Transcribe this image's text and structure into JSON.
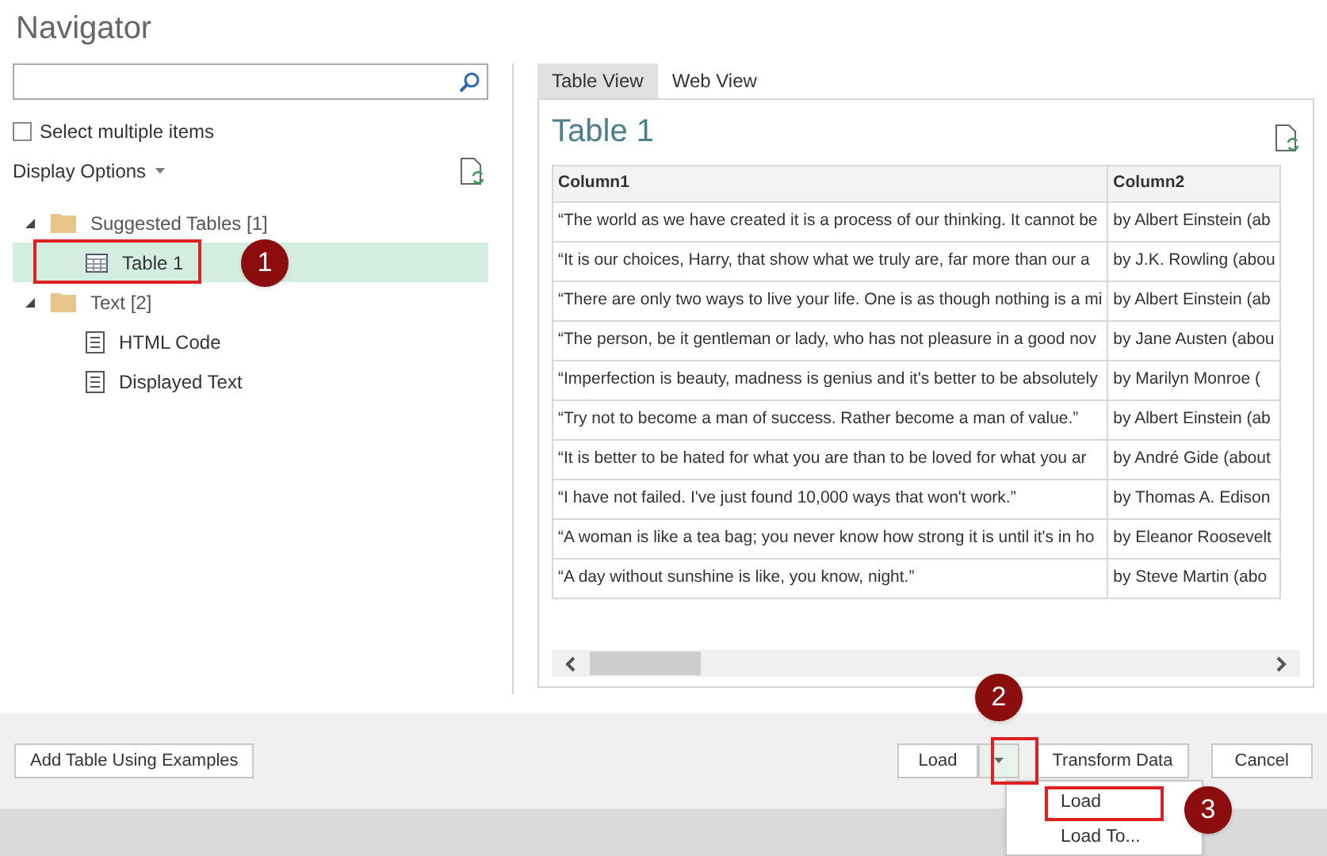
{
  "window": {
    "title": "Navigator"
  },
  "select_multiple": {
    "label": "Select multiple items",
    "checked": false
  },
  "display_options": {
    "label": "Display Options"
  },
  "tree": [
    {
      "label": "Suggested Tables [1]",
      "kind": "folder",
      "expanded": true,
      "selected": false,
      "children": [
        {
          "label": "Table 1",
          "kind": "table",
          "selected": true
        }
      ]
    },
    {
      "label": "Text [2]",
      "kind": "folder",
      "expanded": true,
      "selected": false,
      "children": [
        {
          "label": "HTML Code",
          "kind": "text",
          "selected": false
        },
        {
          "label": "Displayed Text",
          "kind": "text",
          "selected": false
        }
      ]
    }
  ],
  "tabs": [
    {
      "label": "Table View",
      "selected": true
    },
    {
      "label": "Web View",
      "selected": false
    }
  ],
  "preview": {
    "title": "Table 1",
    "columns": [
      "Column1",
      "Column2"
    ],
    "rows": [
      [
        "“The world as we have created it is a process of our thinking. It cannot be",
        "by Albert Einstein (ab"
      ],
      [
        "“It is our choices, Harry, that show what we truly are, far more than our a",
        "by J.K. Rowling (abou"
      ],
      [
        "“There are only two ways to live your life. One is as though nothing is a mi",
        "by Albert Einstein (ab"
      ],
      [
        "“The person, be it gentleman or lady, who has not pleasure in a good nov",
        "by Jane Austen (abou"
      ],
      [
        "“Imperfection is beauty, madness is genius and it's better to be absolutely",
        "by Marilyn Monroe ("
      ],
      [
        "“Try not to become a man of success. Rather become a man of value.”",
        "by Albert Einstein (ab"
      ],
      [
        "“It is better to be hated for what you are than to be loved for what you ar",
        "by André Gide (about"
      ],
      [
        "“I have not failed. I've just found 10,000 ways that won't work.”",
        "by Thomas A. Edison"
      ],
      [
        "“A woman is like a tea bag; you never know how strong it is until it's in ho",
        "by Eleanor Roosevelt"
      ],
      [
        "“A day without sunshine is like, you know, night.”",
        "by Steve Martin (abo"
      ]
    ]
  },
  "footer": {
    "add_table_button": "Add Table Using Examples",
    "load_button": "Load",
    "transform_button": "Transform Data",
    "cancel_button": "Cancel"
  },
  "load_menu": [
    {
      "label": "Load",
      "selected": true
    },
    {
      "label": "Load To...",
      "selected": false
    }
  ],
  "step_markers": [
    "1",
    "2",
    "3"
  ]
}
